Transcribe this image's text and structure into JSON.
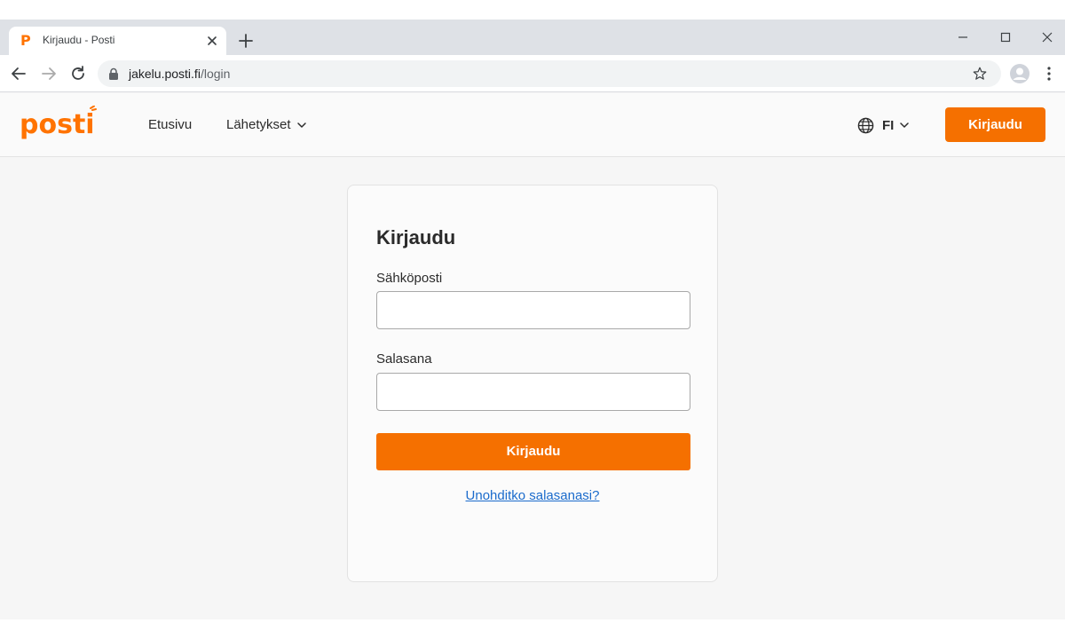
{
  "browser": {
    "tab_title": "Kirjaudu - Posti",
    "tab_favicon": "P",
    "url_host": "jakelu.posti.fi",
    "url_path": "/login",
    "icons": [
      "back-arrow-icon",
      "forward-arrow-icon",
      "reload-icon",
      "lock-icon",
      "star-icon",
      "profile-icon",
      "kebab-menu-icon",
      "close-icon",
      "plus-icon",
      "minimize-icon",
      "maximize-icon"
    ]
  },
  "header": {
    "logo_text": "posti",
    "nav": {
      "home_label": "Etusivu",
      "shipments_label": "Lähetykset"
    },
    "language_code": "FI",
    "login_button": "Kirjaudu"
  },
  "login_card": {
    "title": "Kirjaudu",
    "email_label": "Sähköposti",
    "email_value": "",
    "password_label": "Salasana",
    "password_value": "",
    "submit_label": "Kirjaudu",
    "forgot_link": "Unohditko salasanasi?"
  },
  "colors": {
    "brand_orange": "#f57000",
    "link_blue": "#1a6bcc"
  }
}
